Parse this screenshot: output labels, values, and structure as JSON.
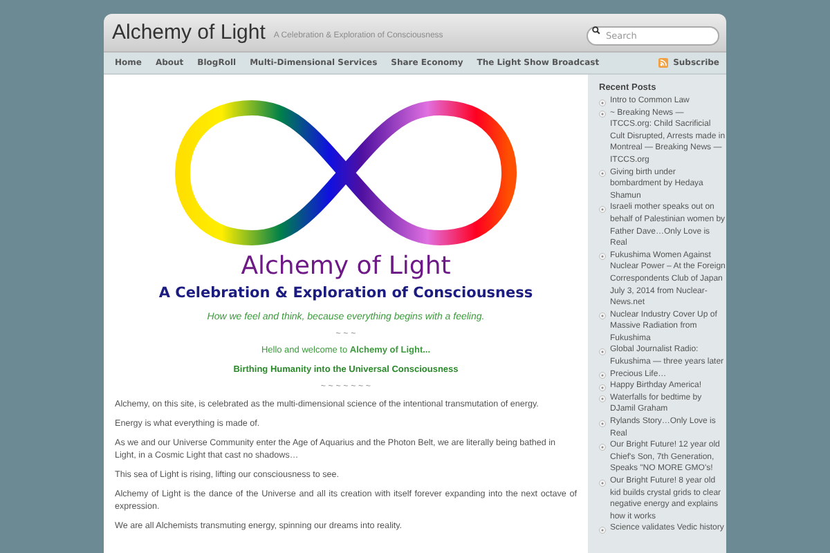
{
  "site": {
    "title": "Alchemy of Light",
    "tagline": "A Celebration & Exploration of Consciousness"
  },
  "search": {
    "placeholder": "Search"
  },
  "nav": {
    "items": [
      {
        "label": "Home"
      },
      {
        "label": "About"
      },
      {
        "label": "BlogRoll"
      },
      {
        "label": "Multi-Dimensional Services"
      },
      {
        "label": "Share Economy"
      },
      {
        "label": "The Light Show Broadcast"
      }
    ],
    "subscribe": "Subscribe"
  },
  "hero": {
    "title": "Alchemy of Light",
    "subtitle": "A Celebration & Exploration of Consciousness",
    "motto": "How we feel and think, because everything begins with a feeling.",
    "divider_1": "~ ~ ~",
    "welcome": "Hello and welcome to **Alchemy of Light...**",
    "birthing": "Birthing Humanity into the Universal Consciousness",
    "divider_2": "~ ~ ~ ~ ~ ~ ~"
  },
  "paragraphs": [
    "Alchemy, on this site, is celebrated as the multi-dimensional science of the intentional transmutation of energy.",
    "Energy is what everything is made of.",
    "As we and our Universe Community enter the Age of Aquarius and the Photon Belt, we are literally being bathed in Light, in a Cosmic Light that cast no shadows…",
    "This sea of Light is rising, lifting our consciousness to see.",
    "Alchemy of Light is the dance of the Universe and all its creation with itself forever expanding into the next octave of expression.",
    "We are all Alchemists transmuting energy, spinning our dreams into reality."
  ],
  "sidebar": {
    "heading": "Recent Posts",
    "posts": [
      "Intro to Common Law",
      "~ Breaking News — ITCCS.org: Child Sacrificial Cult Disrupted, Arrests made in Montreal — Breaking News — ITCCS.org",
      "Giving birth under bombardment by Hedaya Shamun",
      "Israeli mother speaks out on behalf of Palestinian women by Father Dave…Only Love is Real",
      "Fukushima Women Against Nuclear Power – At the Foreign Correspondents Club of Japan July 3, 2014 from Nuclear-News.net",
      "Nuclear Industry Cover Up of Massive Radiation from Fukushima",
      "Global Journalist Radio: Fukushima — three years later",
      "Precious Life…",
      "Happy Birthday America!",
      "Waterfalls for bedtime by DJamil Graham",
      "Rylands Story…Only Love is Real",
      "Our Bright Future! 12 year old Chief's Son, 7th Generation, Speaks \"NO MORE GMO's!",
      "Our Bright Future! 8 year old kid builds crystal grids to clear negative energy and explains how it works",
      "Science validates Vedic history"
    ]
  }
}
